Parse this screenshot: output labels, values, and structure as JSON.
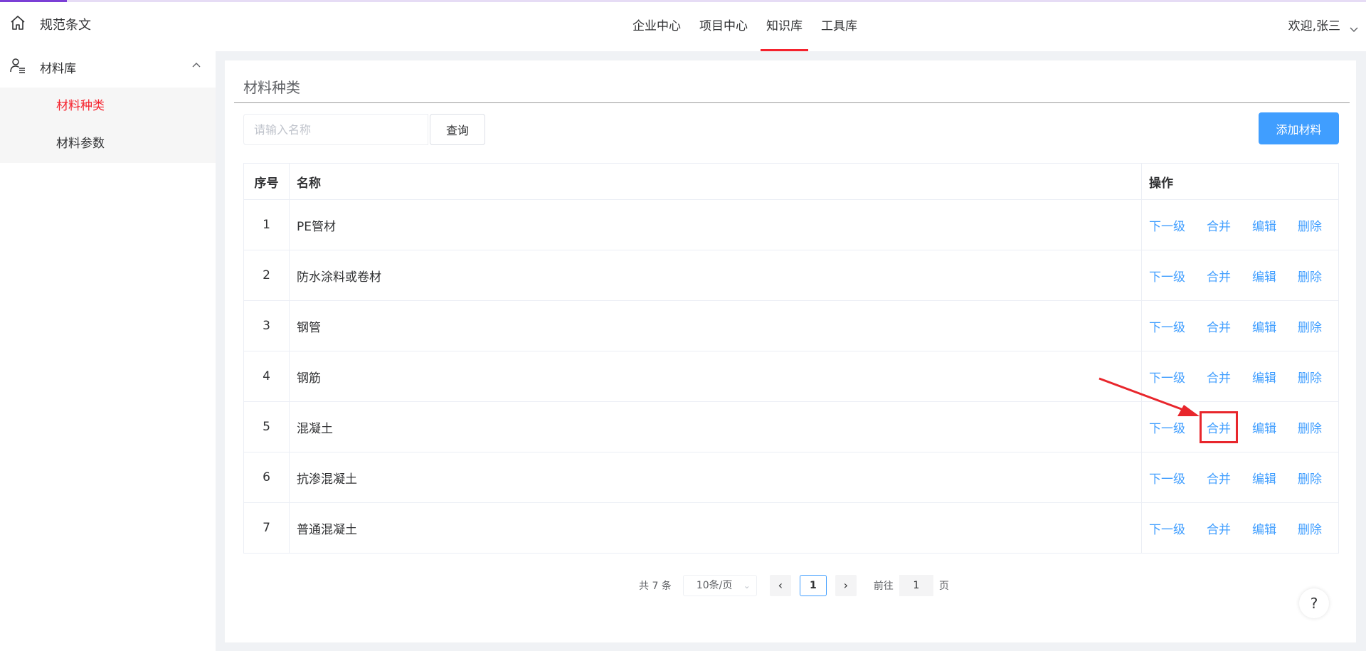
{
  "sidebar": {
    "top_item": {
      "label": "规范条文",
      "icon": "home-icon"
    },
    "group": {
      "label": "材料库",
      "icon": "user-list-icon",
      "expanded": true
    },
    "sub_items": [
      {
        "label": "材料种类",
        "active": true
      },
      {
        "label": "材料参数",
        "active": false
      }
    ]
  },
  "header": {
    "tabs": [
      {
        "label": "企业中心",
        "active": false
      },
      {
        "label": "项目中心",
        "active": false
      },
      {
        "label": "知识库",
        "active": true
      },
      {
        "label": "工具库",
        "active": false
      }
    ],
    "welcome": "欢迎,张三"
  },
  "main": {
    "title": "材料种类",
    "search": {
      "placeholder": "请输入名称",
      "value": "",
      "button": "查询"
    },
    "add_button": "添加材料",
    "table": {
      "headers": {
        "index": "序号",
        "name": "名称",
        "ops": "操作"
      },
      "op_labels": {
        "next": "下一级",
        "merge": "合并",
        "edit": "编辑",
        "delete": "删除"
      },
      "rows": [
        {
          "index": "1",
          "name": "PE管材"
        },
        {
          "index": "2",
          "name": "防水涂料或卷材"
        },
        {
          "index": "3",
          "name": "钢管"
        },
        {
          "index": "4",
          "name": "钢筋"
        },
        {
          "index": "5",
          "name": "混凝土"
        },
        {
          "index": "6",
          "name": "抗渗混凝土"
        },
        {
          "index": "7",
          "name": "普通混凝土"
        }
      ],
      "highlighted": {
        "row": "5",
        "op": "合并"
      }
    },
    "pagination": {
      "total": "共 7 条",
      "page_size": "10条/页",
      "current_page": "1",
      "goto_label": "前往",
      "goto_value": "1",
      "page_unit": "页"
    }
  },
  "help": "?",
  "colors": {
    "primary": "#409eff",
    "active_red": "#f5222d",
    "highlight_box": "#e8262c",
    "top_strip": "#7b3fd6"
  }
}
